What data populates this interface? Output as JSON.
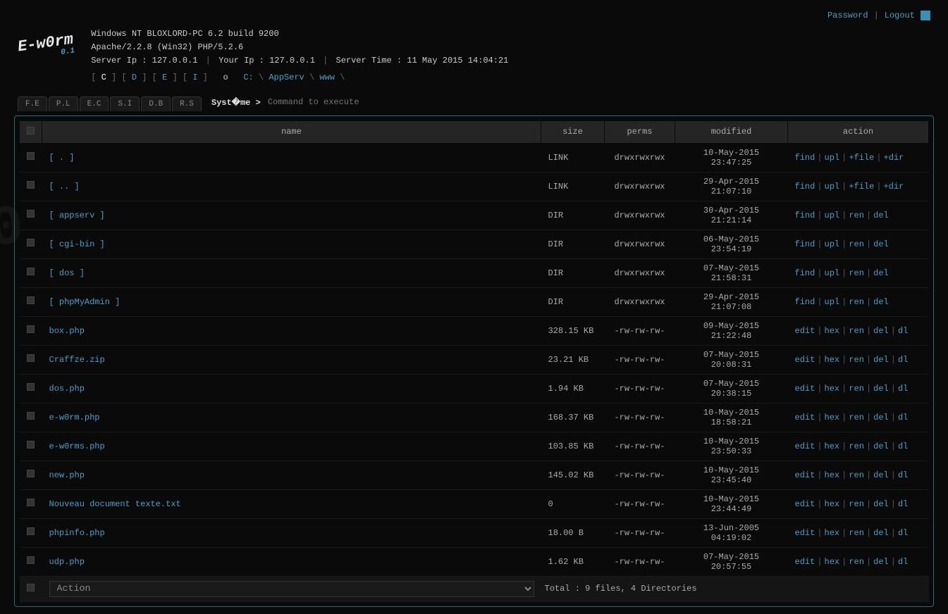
{
  "topbar": {
    "password": "Password",
    "logout": "Logout"
  },
  "logo": {
    "name": "E-w0rm",
    "version": "0.1"
  },
  "sysinfo": {
    "line1": "Windows NT BLOXLORD-PC 6.2 build 9200",
    "line2": "Apache/2.2.8 (Win32) PHP/5.2.6",
    "server_ip_label": "Server Ip : ",
    "server_ip": "127.0.0.1",
    "your_ip_label": "Your Ip : ",
    "your_ip": "127.0.0.1",
    "server_time_label": "Server Time : ",
    "server_time": "11 May 2015 14:04:21"
  },
  "drives": [
    {
      "label": "C",
      "active": true
    },
    {
      "label": "D",
      "active": false
    },
    {
      "label": "E",
      "active": false
    },
    {
      "label": "I",
      "active": false
    }
  ],
  "drive_extra": "o",
  "path": [
    "C:",
    "AppServ",
    "www"
  ],
  "tabs": [
    {
      "label": "F.E"
    },
    {
      "label": "P.L"
    },
    {
      "label": "E.C"
    },
    {
      "label": "S.I"
    },
    {
      "label": "D.B"
    },
    {
      "label": "R.S"
    }
  ],
  "cmd": {
    "label": "Syst�me >",
    "placeholder": "Command to execute"
  },
  "headers": {
    "name": "name",
    "size": "size",
    "perms": "perms",
    "modified": "modified",
    "action": "action"
  },
  "rows": [
    {
      "name": "[ . ]",
      "size": "LINK",
      "perms": "drwxrwxrwx",
      "modified": "10-May-2015 23:47:25",
      "actions": [
        "find",
        "upl",
        "+file",
        "+dir"
      ]
    },
    {
      "name": "[ .. ]",
      "size": "LINK",
      "perms": "drwxrwxrwx",
      "modified": "29-Apr-2015 21:07:10",
      "actions": [
        "find",
        "upl",
        "+file",
        "+dir"
      ]
    },
    {
      "name": "[ appserv ]",
      "size": "DIR",
      "perms": "drwxrwxrwx",
      "modified": "30-Apr-2015 21:21:14",
      "actions": [
        "find",
        "upl",
        "ren",
        "del"
      ]
    },
    {
      "name": "[ cgi-bin ]",
      "size": "DIR",
      "perms": "drwxrwxrwx",
      "modified": "06-May-2015 23:54:19",
      "actions": [
        "find",
        "upl",
        "ren",
        "del"
      ]
    },
    {
      "name": "[ dos ]",
      "size": "DIR",
      "perms": "drwxrwxrwx",
      "modified": "07-May-2015 21:58:31",
      "actions": [
        "find",
        "upl",
        "ren",
        "del"
      ]
    },
    {
      "name": "[ phpMyAdmin ]",
      "size": "DIR",
      "perms": "drwxrwxrwx",
      "modified": "29-Apr-2015 21:07:08",
      "actions": [
        "find",
        "upl",
        "ren",
        "del"
      ]
    },
    {
      "name": "box.php",
      "size": "328.15 KB",
      "perms": "-rw-rw-rw-",
      "modified": "09-May-2015 21:22:48",
      "actions": [
        "edit",
        "hex",
        "ren",
        "del",
        "dl"
      ]
    },
    {
      "name": "Craffze.zip",
      "size": "23.21 KB",
      "perms": "-rw-rw-rw-",
      "modified": "07-May-2015 20:08:31",
      "actions": [
        "edit",
        "hex",
        "ren",
        "del",
        "dl"
      ]
    },
    {
      "name": "dos.php",
      "size": "1.94 KB",
      "perms": "-rw-rw-rw-",
      "modified": "07-May-2015 20:38:15",
      "actions": [
        "edit",
        "hex",
        "ren",
        "del",
        "dl"
      ]
    },
    {
      "name": "e-w0rm.php",
      "size": "168.37 KB",
      "perms": "-rw-rw-rw-",
      "modified": "10-May-2015 18:58:21",
      "actions": [
        "edit",
        "hex",
        "ren",
        "del",
        "dl"
      ]
    },
    {
      "name": "e-w0rms.php",
      "size": "103.85 KB",
      "perms": "-rw-rw-rw-",
      "modified": "10-May-2015 23:50:33",
      "actions": [
        "edit",
        "hex",
        "ren",
        "del",
        "dl"
      ]
    },
    {
      "name": "new.php",
      "size": "145.02 KB",
      "perms": "-rw-rw-rw-",
      "modified": "10-May-2015 23:45:40",
      "actions": [
        "edit",
        "hex",
        "ren",
        "del",
        "dl"
      ]
    },
    {
      "name": "Nouveau document texte.txt",
      "size": "0",
      "perms": "-rw-rw-rw-",
      "modified": "10-May-2015 23:44:49",
      "actions": [
        "edit",
        "hex",
        "ren",
        "del",
        "dl"
      ]
    },
    {
      "name": "phpinfo.php",
      "size": "18.00 B",
      "perms": "-rw-rw-rw-",
      "modified": "13-Jun-2005 04:19:02",
      "actions": [
        "edit",
        "hex",
        "ren",
        "del",
        "dl"
      ]
    },
    {
      "name": "udp.php",
      "size": "1.62 KB",
      "perms": "-rw-rw-rw-",
      "modified": "07-May-2015 20:57:55",
      "actions": [
        "edit",
        "hex",
        "ren",
        "del",
        "dl"
      ]
    }
  ],
  "footer": {
    "action_select": "Action",
    "totals": "Total : 9 files, 4 Directories"
  }
}
